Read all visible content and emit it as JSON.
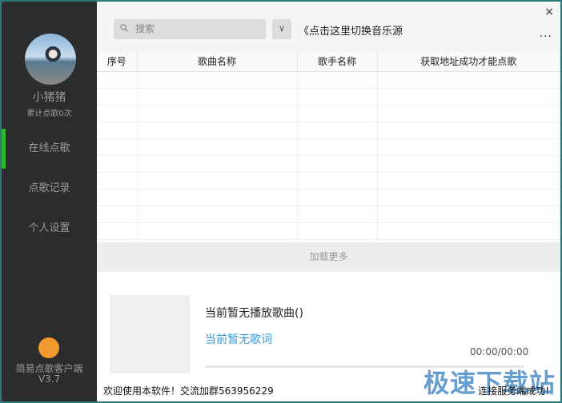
{
  "sidebar": {
    "username": "小猪猪",
    "song_count": "累计点歌0次",
    "items": [
      {
        "label": "在线点歌",
        "active": true
      },
      {
        "label": "点歌记录"
      },
      {
        "label": "个人设置"
      }
    ],
    "app_name": "简易点歌客户端",
    "version": "V3.7"
  },
  "header": {
    "search_placeholder": "搜索",
    "switch_source": "《点击这里切换音乐源",
    "close": "×",
    "more": "···"
  },
  "table": {
    "columns": [
      "序号",
      "歌曲名称",
      "歌手名称",
      "获取地址成功才能点歌"
    ],
    "rows": []
  },
  "load_more": "加载更多",
  "player": {
    "now_playing": "当前暂无播放歌曲()",
    "lyric": "当前暂无歌词",
    "time": "00:00/00:00",
    "progress": 0
  },
  "statusbar": {
    "welcome": "欢迎使用本软件！交流加群563956229",
    "status": "连接服务端成功!"
  },
  "watermark": "极速下载站",
  "colors": {
    "accent": "#2fb52f",
    "lyric": "#3a9ad9",
    "sidebar": "#2b2c2e"
  }
}
